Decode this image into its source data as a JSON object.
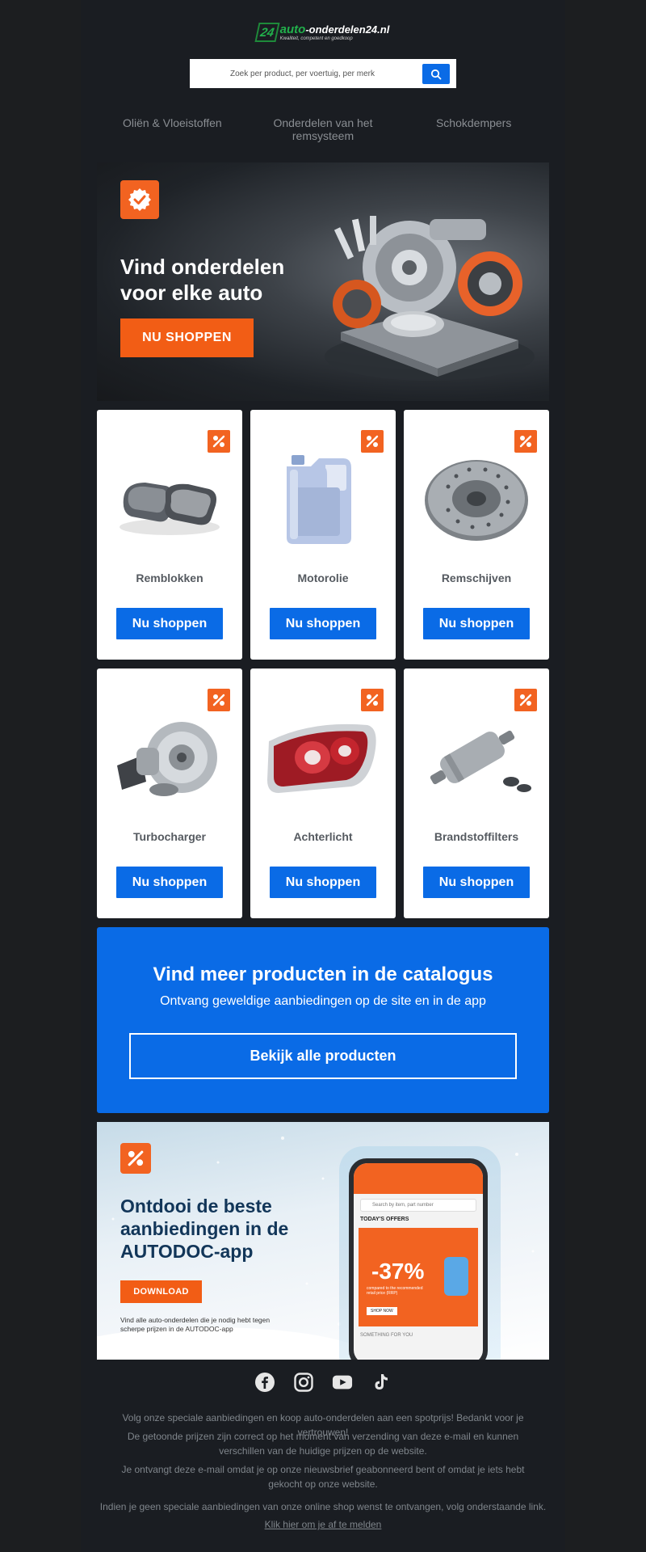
{
  "header": {
    "logo_mark": "24",
    "logo_name_green": "auto",
    "logo_name_white": "-onderdelen24.nl",
    "logo_tagline": "Kwaliteit, competent en goedkoop",
    "search_placeholder": "Zoek per product, per voertuig, per merk"
  },
  "nav": [
    {
      "label": "Oliën & Vloeistoffen"
    },
    {
      "label": "Onderdelen van het remsysteem"
    },
    {
      "label": "Schokdempers"
    }
  ],
  "hero": {
    "title_line1": "Vind onderdelen",
    "title_line2": "voor elke auto",
    "button": "NU SHOPPEN"
  },
  "products": [
    {
      "name": "Remblokken",
      "button": "Nu shoppen",
      "icon": "brake-pads-icon"
    },
    {
      "name": "Motorolie",
      "button": "Nu shoppen",
      "icon": "oil-canister-icon"
    },
    {
      "name": "Remschijven",
      "button": "Nu shoppen",
      "icon": "brake-disc-icon"
    },
    {
      "name": "Turbocharger",
      "button": "Nu shoppen",
      "icon": "turbocharger-icon"
    },
    {
      "name": "Achterlicht",
      "button": "Nu shoppen",
      "icon": "tail-light-icon"
    },
    {
      "name": "Brandstoffilters",
      "button": "Nu shoppen",
      "icon": "fuel-filter-icon"
    }
  ],
  "catalog": {
    "title": "Vind meer producten in de catalogus",
    "subtitle": "Ontvang geweldige aanbiedingen op de site en in de app",
    "button": "Bekijk alle producten"
  },
  "promo": {
    "title": "Ontdooi de beste aanbiedingen in de AUTODOC-app",
    "button": "DOWNLOAD",
    "note": "Vind alle auto-onderdelen die je nodig hebt tegen scherpe prijzen in de AUTODOC-app",
    "screen_search": "Search by item, part number",
    "screen_offers": "TODAY'S OFFERS",
    "screen_discount": "-37%",
    "screen_discount_text": "compared to the recommended retail price (RRP)",
    "screen_shop": "SHOP NOW",
    "screen_footer": "SOMETHING FOR YOU"
  },
  "social": [
    "facebook-icon",
    "instagram-icon",
    "youtube-icon",
    "tiktok-icon"
  ],
  "footer": {
    "line1": "Volg onze speciale aanbiedingen en koop auto-onderdelen aan een spotprijs! Bedankt voor je vertrouwen!",
    "line2": "De getoonde prijzen zijn correct op het moment van verzending van deze e-mail en kunnen verschillen van de huidige prijzen op de website.",
    "line3": "Je ontvangt deze e-mail omdat je op onze nieuwsbrief geabonneerd bent of omdat je iets hebt gekocht op onze website.",
    "line4": "Indien je geen speciale aanbiedingen van onze online shop wenst te ontvangen, volg onderstaande link.",
    "unsubscribe": "Klik hier om je af te melden"
  },
  "colors": {
    "background": "#1a1d22",
    "accent_orange": "#f26321",
    "accent_blue": "#0a6be6"
  }
}
